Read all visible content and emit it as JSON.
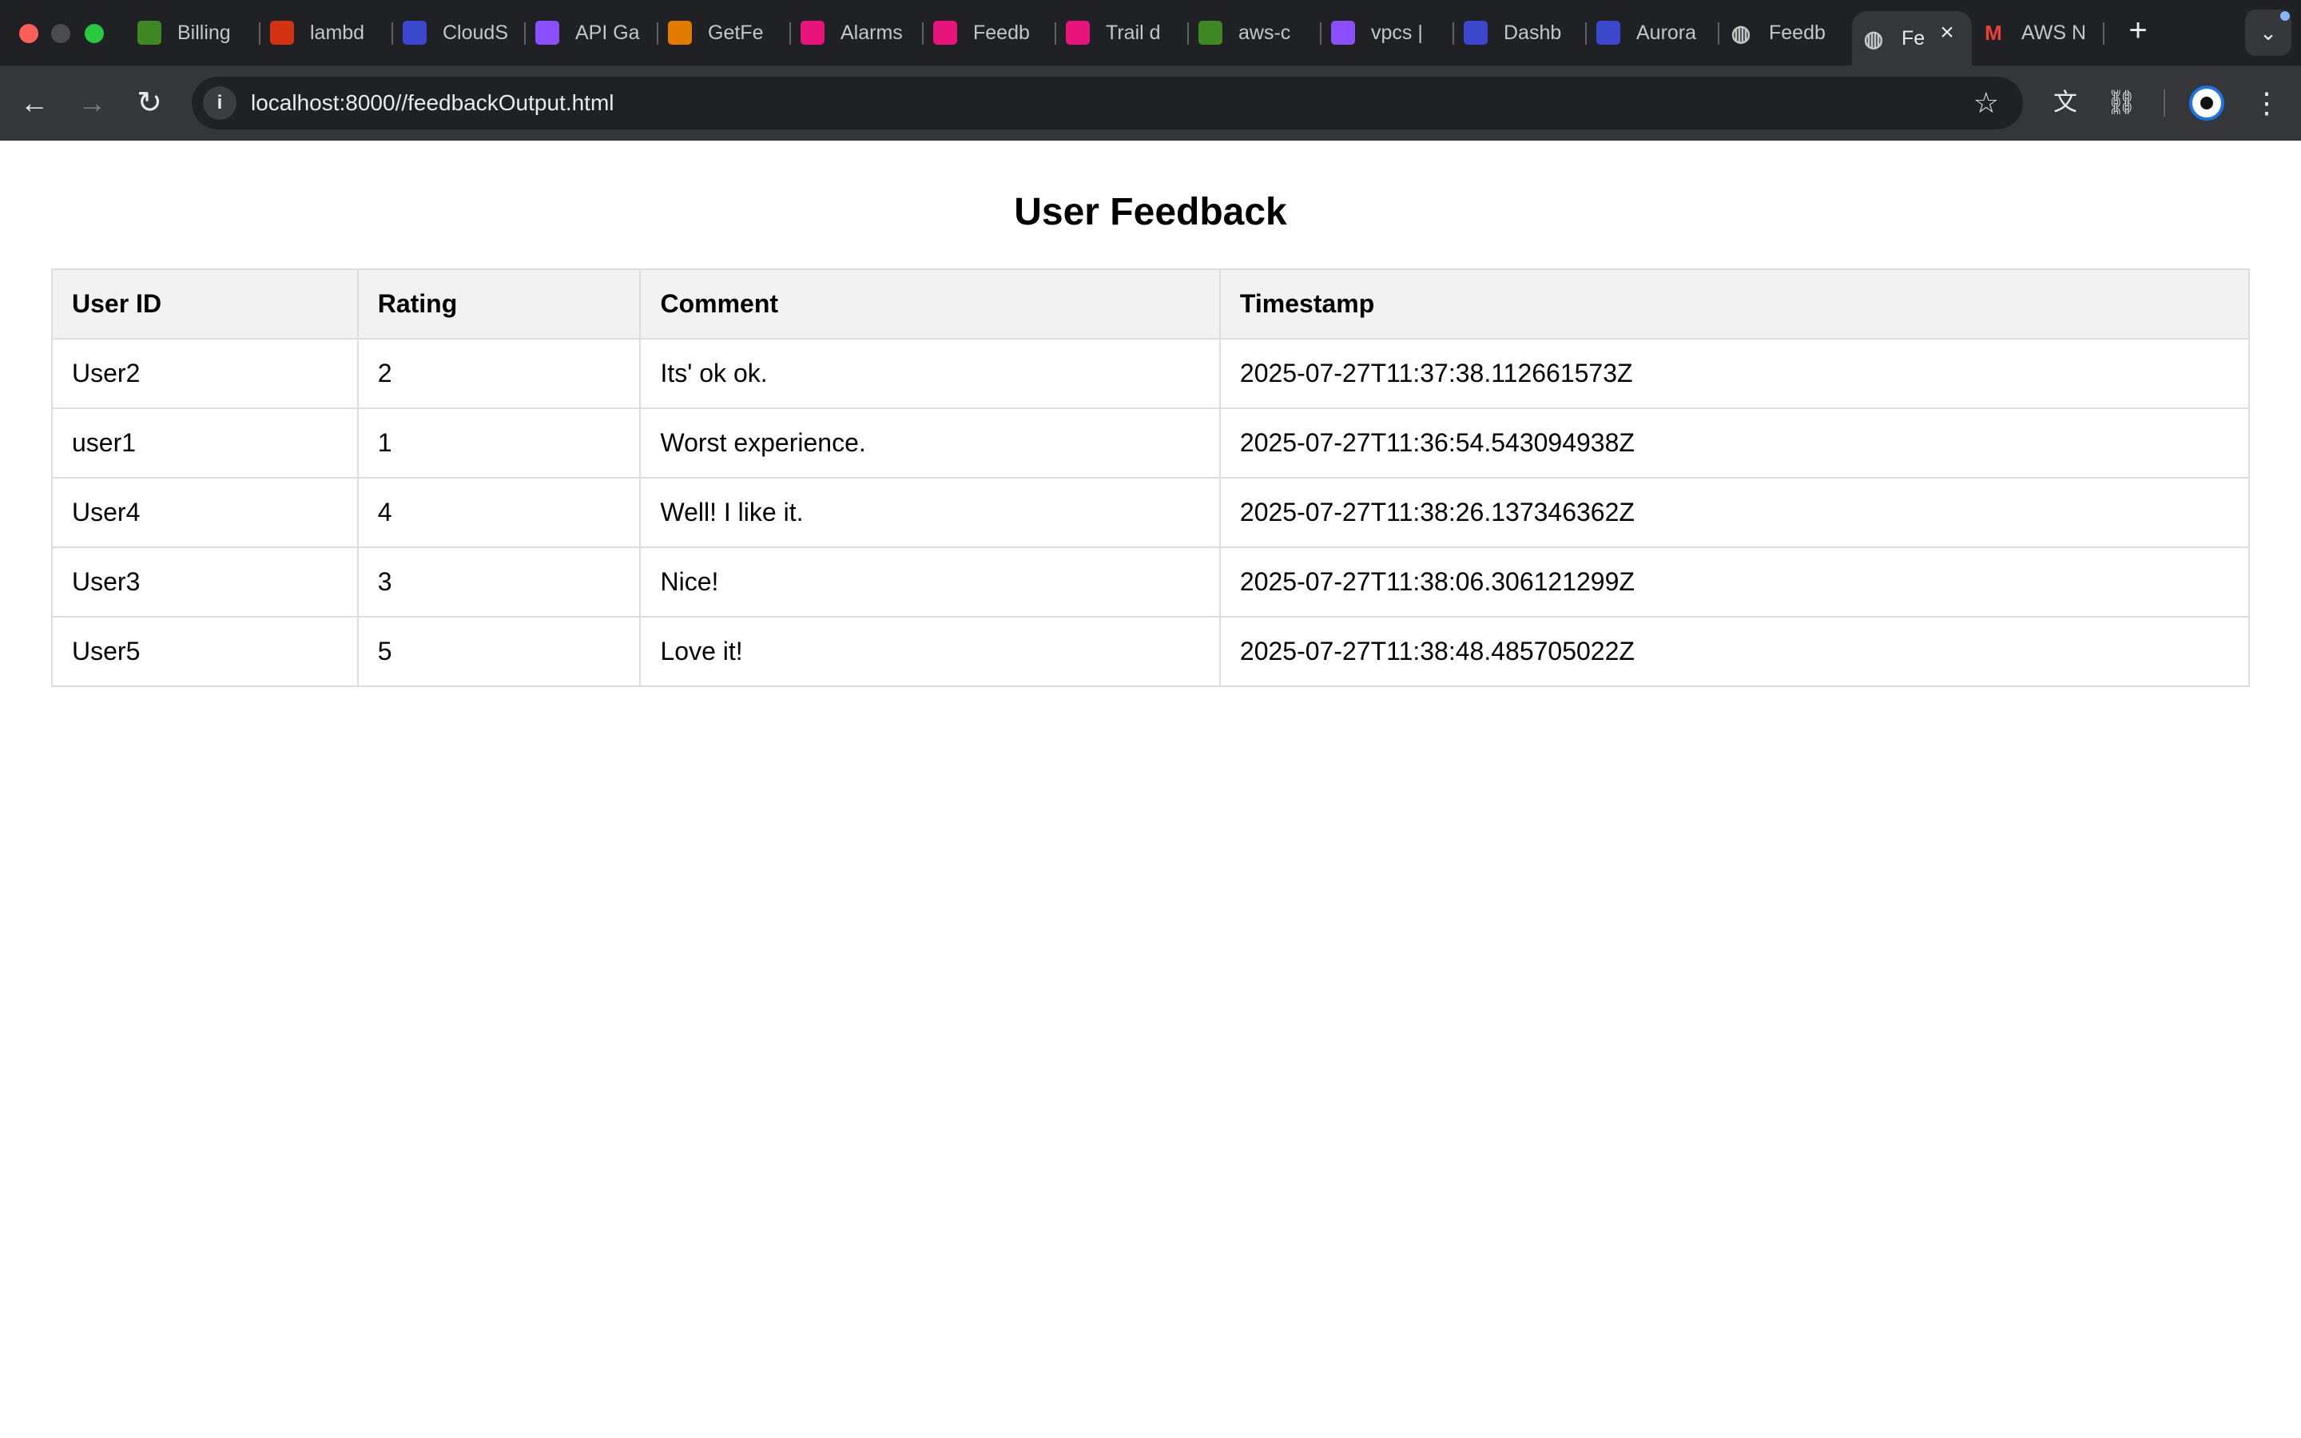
{
  "browser": {
    "tabs": [
      {
        "label": "Billing",
        "icon": "billing-icon",
        "color": "#3f8624"
      },
      {
        "label": "lambd",
        "icon": "lambda-icon",
        "color": "#d13212"
      },
      {
        "label": "CloudS",
        "icon": "cloudshell-icon",
        "color": "#3b48cc"
      },
      {
        "label": "API Ga",
        "icon": "api-gateway-icon",
        "color": "#8c4fff"
      },
      {
        "label": "GetFe",
        "icon": "lambda-function-icon",
        "color": "#e07b00"
      },
      {
        "label": "Alarms",
        "icon": "cloudwatch-alarms-icon",
        "color": "#e7157b"
      },
      {
        "label": "Feedb",
        "icon": "dynamodb-icon",
        "color": "#e7157b"
      },
      {
        "label": "Trail d",
        "icon": "cloudtrail-icon",
        "color": "#e7157b"
      },
      {
        "label": "aws-c",
        "icon": "s3-icon",
        "color": "#3f8624"
      },
      {
        "label": "vpcs |",
        "icon": "vpc-icon",
        "color": "#8c4fff"
      },
      {
        "label": "Dashb",
        "icon": "dashboard-icon",
        "color": "#3b48cc"
      },
      {
        "label": "Aurora",
        "icon": "aurora-icon",
        "color": "#3b48cc"
      },
      {
        "label": "Feedb",
        "icon": "globe-icon",
        "color": "#5f6368"
      },
      {
        "label": "Fe",
        "icon": "globe-icon",
        "color": "#5f6368",
        "active": true
      },
      {
        "label": "AWS N",
        "icon": "gmail-icon",
        "color": "#ea4335"
      }
    ],
    "url": "localhost:8000//feedbackOutput.html"
  },
  "page": {
    "title": "User Feedback",
    "table": {
      "headers": [
        "User ID",
        "Rating",
        "Comment",
        "Timestamp"
      ],
      "rows": [
        [
          "User2",
          "2",
          "Its' ok ok.",
          "2025-07-27T11:37:38.112661573Z"
        ],
        [
          "user1",
          "1",
          "Worst experience.",
          "2025-07-27T11:36:54.543094938Z"
        ],
        [
          "User4",
          "4",
          "Well! I like it.",
          "2025-07-27T11:38:26.137346362Z"
        ],
        [
          "User3",
          "3",
          "Nice!",
          "2025-07-27T11:38:06.306121299Z"
        ],
        [
          "User5",
          "5",
          "Love it!",
          "2025-07-27T11:38:48.485705022Z"
        ]
      ]
    }
  }
}
